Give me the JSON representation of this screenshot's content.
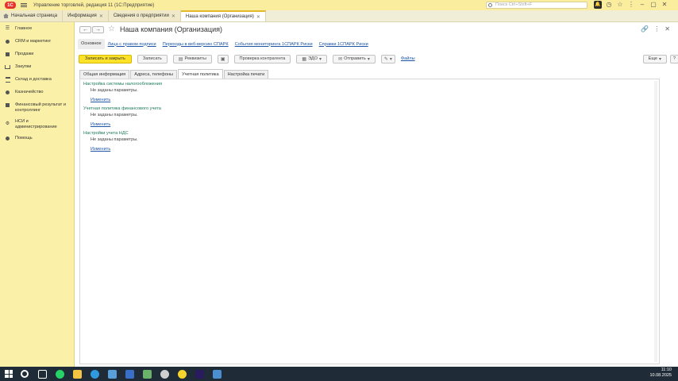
{
  "titlebar": {
    "logo": "1С",
    "app_title": "Управление торговлей, редакция 11   (1С:Предприятие)",
    "search_placeholder": "Поиск Ctrl+Shift+F"
  },
  "tabs": [
    {
      "label": "Начальная страница"
    },
    {
      "label": "Информация"
    },
    {
      "label": "Сведения о предприятии"
    },
    {
      "label": "Наша компания (Организация)"
    }
  ],
  "sidebar": {
    "items": [
      {
        "label": "Главное",
        "icon": "menu-icon"
      },
      {
        "label": "CRM и маркетинг",
        "icon": "crm-icon"
      },
      {
        "label": "Продажи",
        "icon": "sales-icon"
      },
      {
        "label": "Закупки",
        "icon": "cart-icon"
      },
      {
        "label": "Склад и доставка",
        "icon": "warehouse-icon"
      },
      {
        "label": "Казначейство",
        "icon": "treasury-icon"
      },
      {
        "label": "Финансовый результат и контроллинг",
        "icon": "finance-icon"
      },
      {
        "label": "НСИ и администрирование",
        "icon": "gear-icon"
      },
      {
        "label": "Помощь",
        "icon": "help-icon"
      }
    ]
  },
  "page": {
    "title": "Наша компания (Организация)"
  },
  "subtabs": [
    {
      "label": "Основное"
    },
    {
      "label": "Лица с правом подписи"
    },
    {
      "label": "Переходы в веб-версию СПАРК"
    },
    {
      "label": "События мониторинга 1СПАРК Риски"
    },
    {
      "label": "Справки 1СПАРК Риски"
    }
  ],
  "toolbar": {
    "save_close": "Записать и закрыть",
    "save": "Записать",
    "requisites": "Реквизиты",
    "check": "Проверка контрагента",
    "edo": "ЭДО",
    "send": "Отправить",
    "files": "Файлы",
    "more": "Еще"
  },
  "form_tabs": [
    {
      "label": "Общая информация"
    },
    {
      "label": "Адреса, телефоны"
    },
    {
      "label": "Учетная политика"
    },
    {
      "label": "Настройка печати"
    }
  ],
  "sections": [
    {
      "title": "Настройка системы налогообложения",
      "value": "Не заданы параметры.",
      "link": "Изменить"
    },
    {
      "title": "Учетная политика финансового учета",
      "value": "Не заданы параметры.",
      "link": "Изменить"
    },
    {
      "title": "Настройки учета НДС",
      "value": "Не заданы параметры.",
      "link": "Изменить"
    }
  ],
  "clock": {
    "time": "11:10",
    "date": "10.08.2025"
  },
  "colors": {
    "sidebar": "#fbf0a8",
    "titlebar": "#fbed9e",
    "primary_button": "#fde22a",
    "link": "#1e55a5",
    "section_title": "#1a7a58"
  }
}
